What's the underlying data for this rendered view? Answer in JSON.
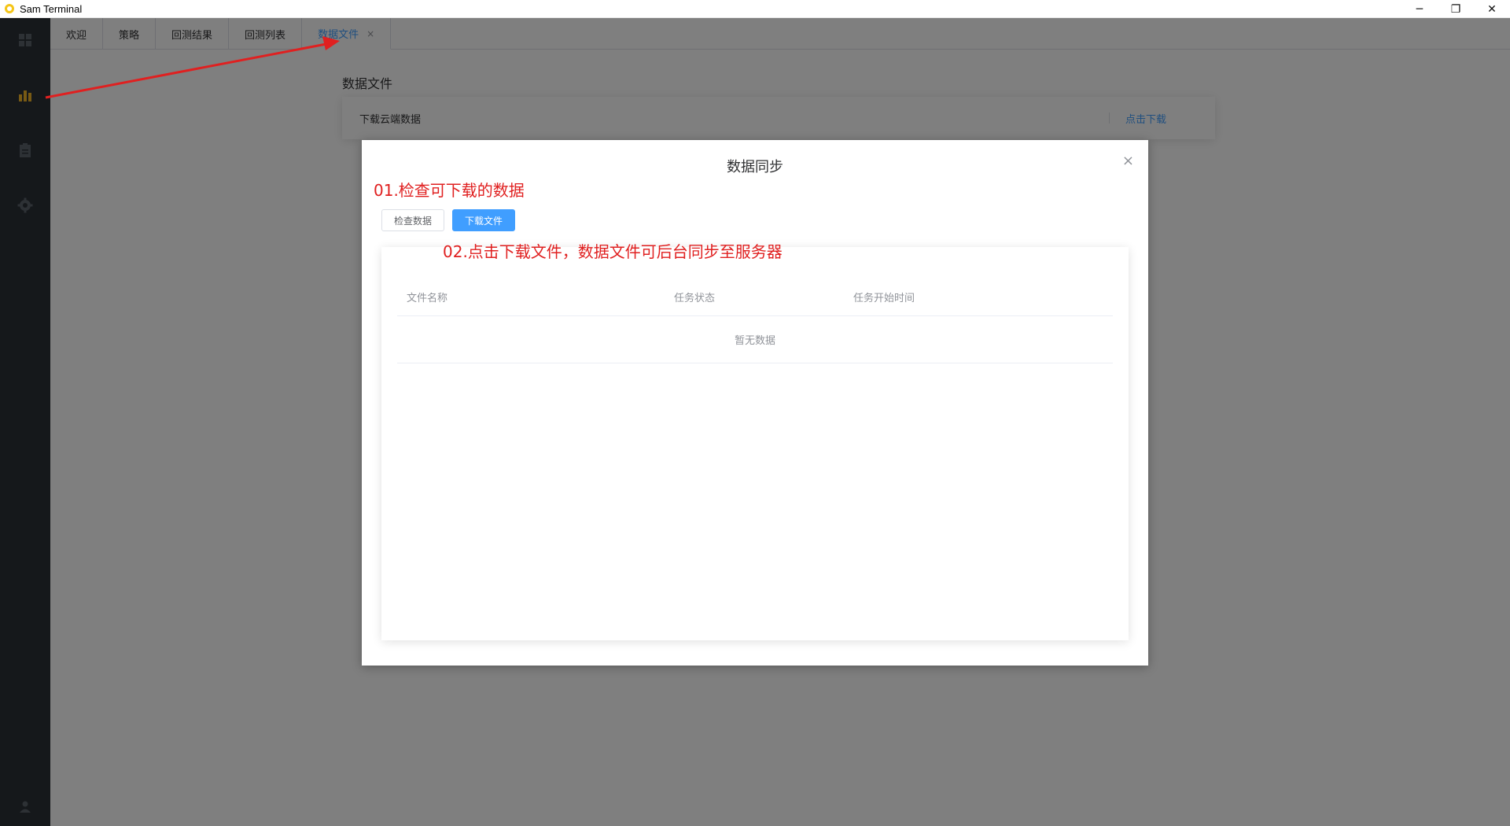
{
  "window": {
    "title": "Sam Terminal",
    "controls": {
      "minimize": "─",
      "restore": "❐",
      "close": "✕"
    }
  },
  "sidebar": {
    "items": [
      {
        "icon": "grid-icon",
        "active": false
      },
      {
        "icon": "bar-chart-icon",
        "active": true
      },
      {
        "icon": "clipboard-icon",
        "active": false
      },
      {
        "icon": "gear-icon",
        "active": false
      }
    ],
    "bottom_icon": "user-icon"
  },
  "tabs": [
    {
      "label": "欢迎"
    },
    {
      "label": "策略"
    },
    {
      "label": "回测结果"
    },
    {
      "label": "回测列表"
    },
    {
      "label": "数据文件",
      "active": true,
      "close": "×"
    }
  ],
  "page": {
    "heading": "数据文件",
    "card": {
      "label": "下载云端数据",
      "link": "点击下载"
    }
  },
  "dialog": {
    "title": "数据同步",
    "close": "×",
    "buttons": {
      "check": "检查数据",
      "download": "下载文件"
    },
    "table": {
      "columns": [
        "文件名称",
        "任务状态",
        "任务开始时间"
      ],
      "empty_text": "暂无数据"
    }
  },
  "annotations": {
    "step1": "01.检查可下载的数据",
    "step2": "02.点击下载文件，数据文件可后台同步至服务器"
  },
  "colors": {
    "accent": "#409eff",
    "annotation": "#e02020",
    "sidebar_bg": "#2b3036",
    "sidebar_active": "#f0b429"
  }
}
